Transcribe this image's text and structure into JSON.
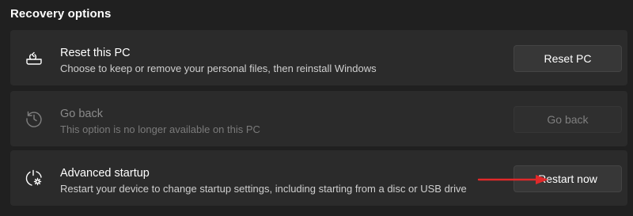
{
  "section": {
    "title": "Recovery options"
  },
  "options": [
    {
      "icon": "reset-pc-icon",
      "title": "Reset this PC",
      "description": "Choose to keep or remove your personal files, then reinstall Windows",
      "button_label": "Reset PC",
      "enabled": true
    },
    {
      "icon": "history-icon",
      "title": "Go back",
      "description": "This option is no longer available on this PC",
      "button_label": "Go back",
      "enabled": false
    },
    {
      "icon": "advanced-startup-icon",
      "title": "Advanced startup",
      "description": "Restart your device to change startup settings, including starting from a disc or USB drive",
      "button_label": "Restart now",
      "enabled": true
    }
  ],
  "colors": {
    "background": "#202020",
    "card": "#2b2b2b",
    "button": "#373737",
    "annotation_arrow": "#e0292a"
  }
}
